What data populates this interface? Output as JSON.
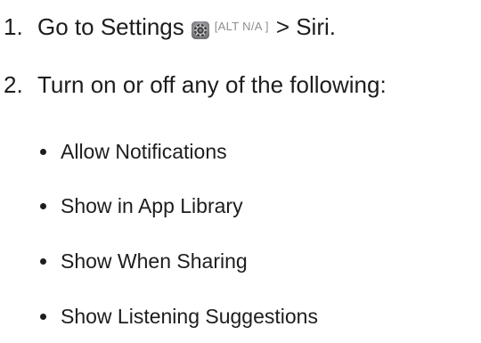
{
  "steps": [
    {
      "number": "1.",
      "text_before": "Go to Settings",
      "icon": "settings-gear-icon",
      "alt_note": "[ALT N/A ]",
      "text_after": "> Siri."
    },
    {
      "number": "2.",
      "text": "Turn on or off any of the following:"
    }
  ],
  "options": [
    "Allow Notifications",
    "Show in App Library",
    "Show When Sharing",
    "Show Listening Suggestions"
  ],
  "colors": {
    "text": "#1d1d1f",
    "alt_note": "#8e8e93"
  }
}
